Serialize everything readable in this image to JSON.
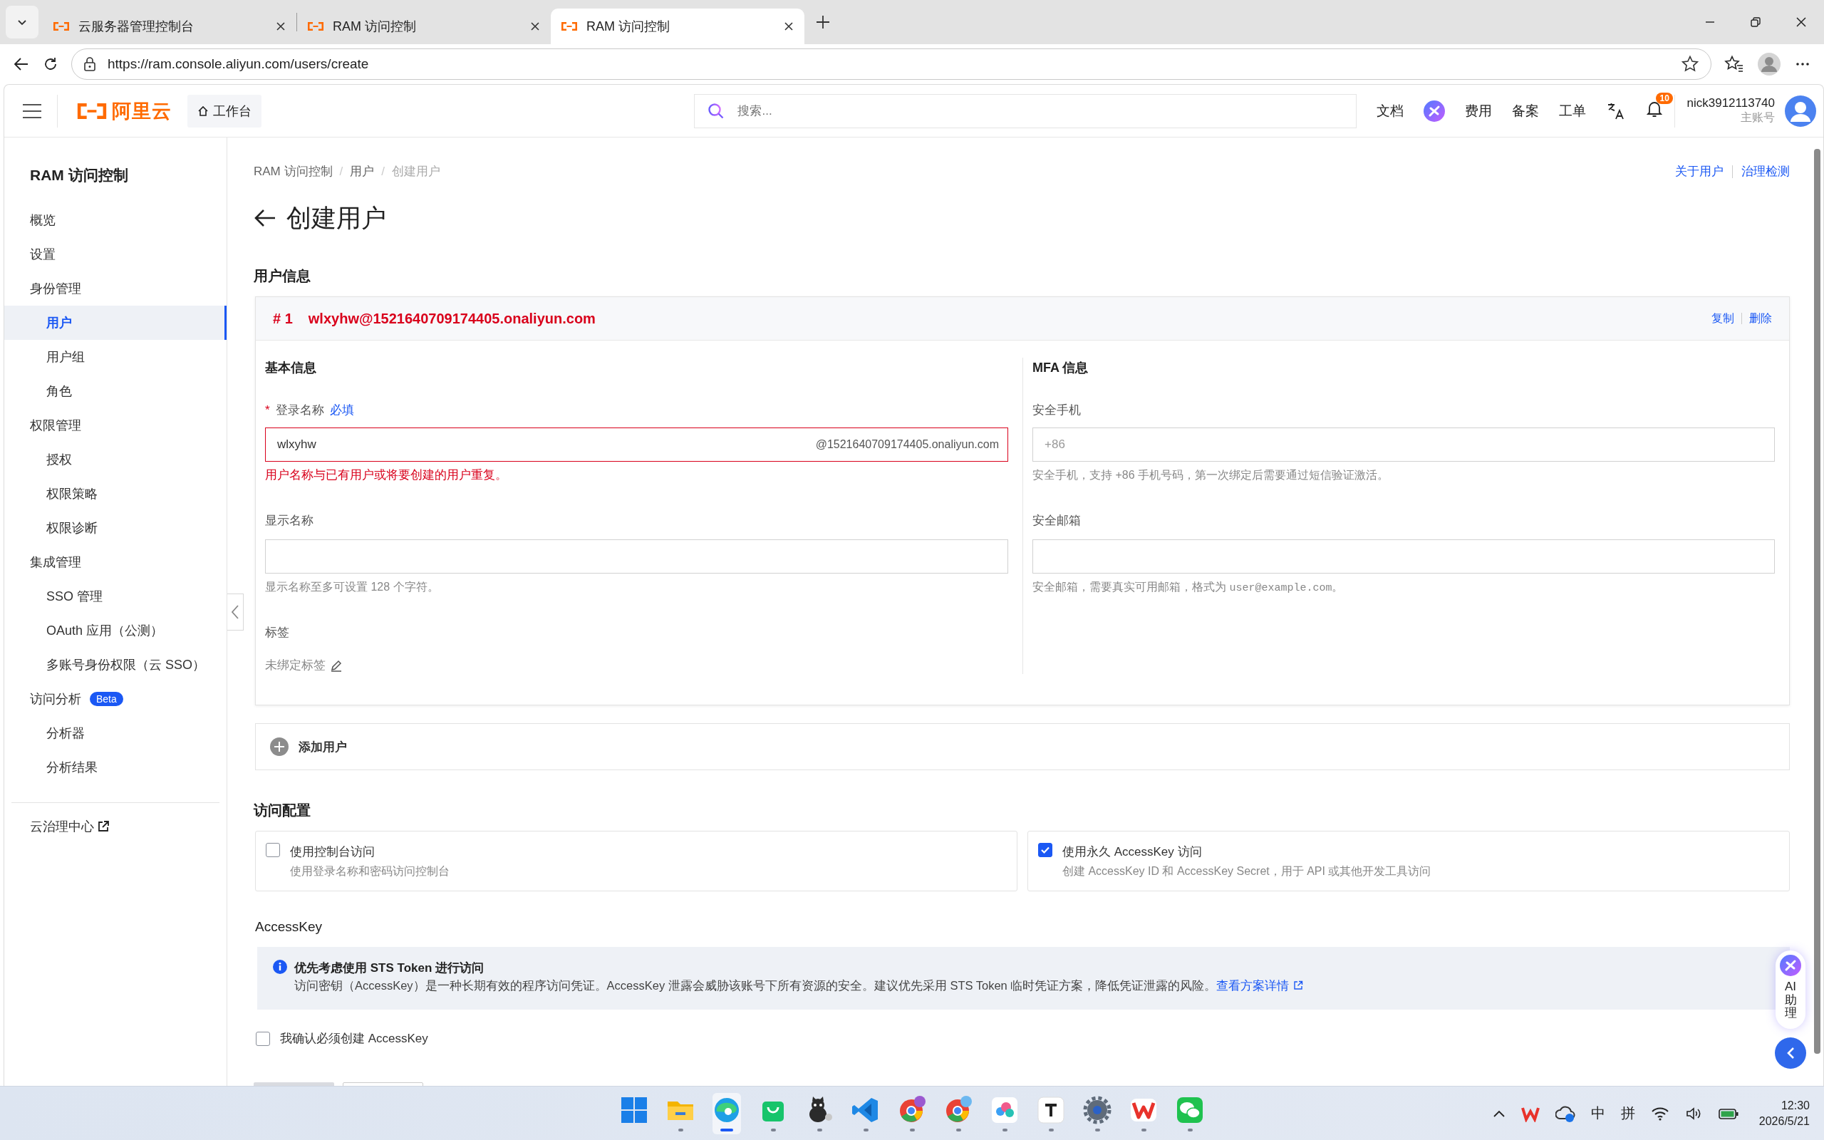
{
  "browser": {
    "tabs": [
      {
        "title": "云服务器管理控制台",
        "selected": false
      },
      {
        "title": "RAM 访问控制",
        "selected": false
      },
      {
        "title": "RAM 访问控制",
        "selected": true
      }
    ],
    "url": "https://ram.console.aliyun.com/users/create"
  },
  "header": {
    "logo": "阿里云",
    "workbench": "工作台",
    "search_placeholder": "搜索...",
    "links": [
      "文档",
      "费用",
      "备案",
      "工单"
    ],
    "notifications": "10",
    "username": "nick3912113740",
    "account_type": "主账号"
  },
  "sidebar": {
    "title": "RAM 访问控制",
    "items": [
      {
        "label": "概览",
        "selected": false
      },
      {
        "label": "设置",
        "selected": false
      },
      {
        "label": "身份管理",
        "selected": false,
        "children": [
          {
            "label": "用户",
            "selected": true
          },
          {
            "label": "用户组",
            "selected": false
          },
          {
            "label": "角色",
            "selected": false
          }
        ]
      },
      {
        "label": "权限管理",
        "selected": false,
        "children": [
          {
            "label": "授权",
            "selected": false
          },
          {
            "label": "权限策略",
            "selected": false
          },
          {
            "label": "权限诊断",
            "selected": false
          }
        ]
      },
      {
        "label": "集成管理",
        "selected": false,
        "children": [
          {
            "label": "SSO 管理",
            "selected": false
          },
          {
            "label": "OAuth 应用（公测）",
            "selected": false
          },
          {
            "label": "多账号身份权限（云 SSO）",
            "selected": false
          }
        ]
      },
      {
        "label": "访问分析",
        "selected": false,
        "badge": "Beta",
        "children": [
          {
            "label": "分析器",
            "selected": false
          },
          {
            "label": "分析结果",
            "selected": false
          }
        ]
      }
    ],
    "footer_link": "云治理中心"
  },
  "main": {
    "breadcrumb": [
      "RAM 访问控制",
      "用户",
      "创建用户"
    ],
    "breadcrumb_separators": [
      "/",
      "/"
    ],
    "title": "创建用户",
    "top_links": [
      "关于用户",
      "治理检测"
    ],
    "user_info": {
      "heading": "用户信息",
      "users": [
        {
          "index": "# 1",
          "account": "wlxyhw@1521640709174405.onaliyun.com",
          "actions": [
            "复制",
            "删除"
          ],
          "basic": {
            "heading": "基本信息",
            "login_name": {
              "required_mark": "*",
              "label": "登录名称",
              "required_hint": "必填",
              "value": "wlxyhw",
              "suffix": "@1521640709174405.onaliyun.com",
              "error": "用户名称与已有用户或将要创建的用户重复。"
            },
            "display_name": {
              "label": "显示名称",
              "help": "显示名称至多可设置 128 个字符。"
            },
            "tags": {
              "label": "标签",
              "value": "未绑定标签"
            }
          },
          "mfa": {
            "heading": "MFA 信息",
            "phone": {
              "label": "安全手机",
              "placeholder": "+86",
              "help": "安全手机，支持 +86 手机号码，第一次绑定后需要通过短信验证激活。"
            },
            "email": {
              "label": "安全邮箱",
              "help_parts": [
                {
                  "kind": "text",
                  "text": "安全邮箱，需要真实可用邮箱，格式为 "
                },
                {
                  "kind": "code",
                  "text": "user@example.com"
                },
                {
                  "kind": "text",
                  "text": "。"
                }
              ]
            }
          }
        }
      ],
      "add_user": "添加用户"
    },
    "access_config": {
      "heading": "访问配置",
      "options": [
        {
          "title": "使用控制台访问",
          "description": "使用登录名称和密码访问控制台",
          "checked": false
        },
        {
          "title": "使用永久 AccessKey 访问",
          "description": "创建 AccessKey ID 和 AccessKey Secret，用于 API 或其他开发工具访问",
          "checked": true
        }
      ]
    },
    "accesskey": {
      "heading": "AccessKey",
      "alert": {
        "title": "优先考虑使用 STS Token 进行访问",
        "text": "访问密钥（AccessKey）是一种长期有效的程序访问凭证。AccessKey 泄露会威胁该账号下所有资源的安全。建议优先采用 STS Token 临时凭证方案，降低凭证泄露的风险。",
        "link": "查看方案详情"
      },
      "confirm": {
        "label": "我确认必须创建 AccessKey",
        "checked": false
      }
    }
  },
  "ai_assistant": {
    "label": "AI 助理"
  },
  "taskbar": {
    "ime": [
      "中",
      "拼"
    ],
    "time": "12:30",
    "date": "2026/5/21"
  }
}
